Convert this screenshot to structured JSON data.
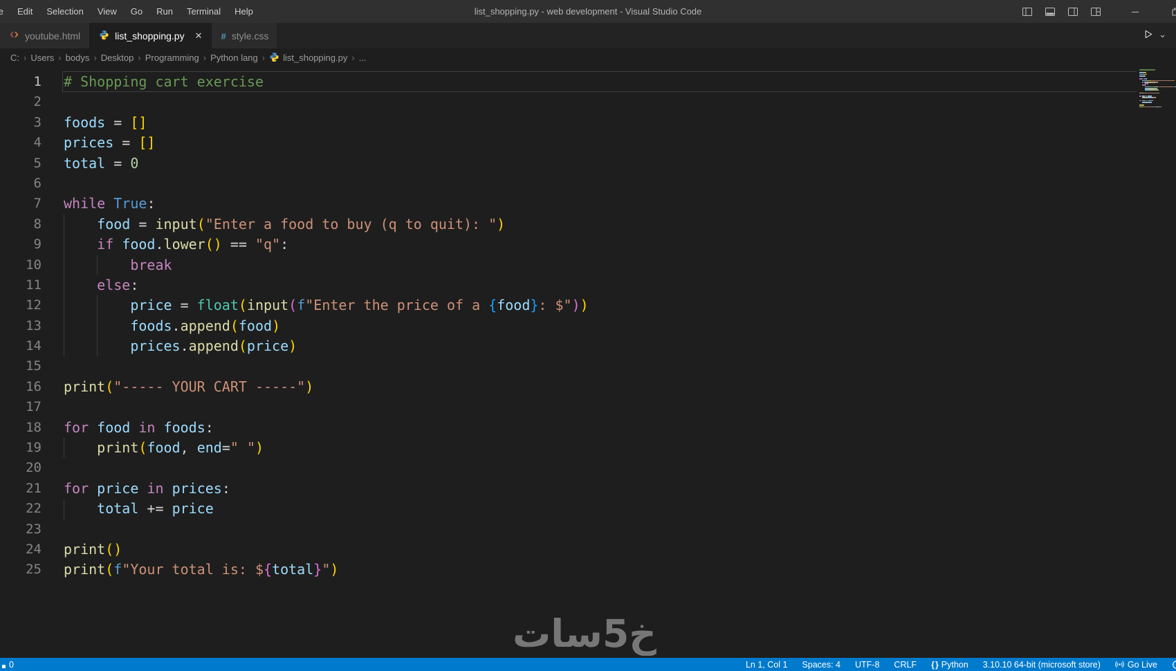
{
  "window": {
    "title": "list_shopping.py - web development - Visual Studio Code",
    "menu_items": [
      "File",
      "Edit",
      "Selection",
      "View",
      "Go",
      "Run",
      "Terminal",
      "Help"
    ],
    "controls": [
      "layout-sidebar-left-icon",
      "layout-panel-icon",
      "layout-sidebar-right-icon",
      "layout-customize-icon",
      "minimize-icon",
      "restore-icon"
    ]
  },
  "tab_bar": {
    "tabs": [
      {
        "label": "youtube.html",
        "icon": "html-icon",
        "active": false
      },
      {
        "label": "list_shopping.py",
        "icon": "python-icon",
        "active": true,
        "close": "✕"
      },
      {
        "label": "style.css",
        "icon": "css-icon",
        "active": false
      }
    ],
    "run_icon": "play-icon",
    "run_dropdown": "⌄"
  },
  "breadcrumb": {
    "items": [
      {
        "label": "C:"
      },
      {
        "label": "Users"
      },
      {
        "label": "bodys"
      },
      {
        "label": "Desktop"
      },
      {
        "label": "Programming"
      },
      {
        "label": "Python lang"
      },
      {
        "label": "list_shopping.py",
        "icon": "python-icon"
      },
      {
        "label": "..."
      }
    ],
    "separator": "›"
  },
  "editor": {
    "palette": {
      "ws": "#d4d4d4",
      "comment": "#6a9955",
      "var": "#9cdcfe",
      "kw": "#c586c0",
      "const": "#569cd6",
      "func": "#dcdcaa",
      "type": "#4ec9b0",
      "str": "#ce9178",
      "num": "#b5cea8",
      "op": "#d4d4d4",
      "b1": "#ffd700",
      "b2": "#da70d6",
      "b3": "#179fff"
    },
    "cursor": "Ln 1, Col 1",
    "lines": [
      {
        "n": 1,
        "current": true,
        "spans": [
          {
            "t": "# Shopping cart exercise",
            "c": "comment"
          }
        ]
      },
      {
        "n": 2,
        "spans": []
      },
      {
        "n": 3,
        "spans": [
          {
            "t": "foods",
            "c": "var"
          },
          {
            "t": " = ",
            "c": "op"
          },
          {
            "t": "[]",
            "c": "b1"
          }
        ]
      },
      {
        "n": 4,
        "spans": [
          {
            "t": "prices",
            "c": "var"
          },
          {
            "t": " = ",
            "c": "op"
          },
          {
            "t": "[]",
            "c": "b1"
          }
        ]
      },
      {
        "n": 5,
        "spans": [
          {
            "t": "total",
            "c": "var"
          },
          {
            "t": " = ",
            "c": "op"
          },
          {
            "t": "0",
            "c": "num"
          }
        ]
      },
      {
        "n": 6,
        "spans": []
      },
      {
        "n": 7,
        "spans": [
          {
            "t": "while",
            "c": "kw"
          },
          {
            "t": " ",
            "c": "ws"
          },
          {
            "t": "True",
            "c": "const"
          },
          {
            "t": ":",
            "c": "op"
          }
        ]
      },
      {
        "n": 8,
        "guides": [
          0
        ],
        "spans": [
          {
            "t": "    ",
            "c": "ws"
          },
          {
            "t": "food",
            "c": "var"
          },
          {
            "t": " = ",
            "c": "op"
          },
          {
            "t": "input",
            "c": "func"
          },
          {
            "t": "(",
            "c": "b1"
          },
          {
            "t": "\"Enter a food to buy (q to quit): \"",
            "c": "str"
          },
          {
            "t": ")",
            "c": "b1"
          }
        ]
      },
      {
        "n": 9,
        "guides": [
          0
        ],
        "spans": [
          {
            "t": "    ",
            "c": "ws"
          },
          {
            "t": "if",
            "c": "kw"
          },
          {
            "t": " ",
            "c": "ws"
          },
          {
            "t": "food",
            "c": "var"
          },
          {
            "t": ".",
            "c": "op"
          },
          {
            "t": "lower",
            "c": "func"
          },
          {
            "t": "()",
            "c": "b1"
          },
          {
            "t": " == ",
            "c": "op"
          },
          {
            "t": "\"q\"",
            "c": "str"
          },
          {
            "t": ":",
            "c": "op"
          }
        ]
      },
      {
        "n": 10,
        "guides": [
          0,
          1
        ],
        "spans": [
          {
            "t": "        ",
            "c": "ws"
          },
          {
            "t": "break",
            "c": "kw"
          }
        ]
      },
      {
        "n": 11,
        "guides": [
          0
        ],
        "spans": [
          {
            "t": "    ",
            "c": "ws"
          },
          {
            "t": "else",
            "c": "kw"
          },
          {
            "t": ":",
            "c": "op"
          }
        ]
      },
      {
        "n": 12,
        "guides": [
          0,
          1
        ],
        "spans": [
          {
            "t": "        ",
            "c": "ws"
          },
          {
            "t": "price",
            "c": "var"
          },
          {
            "t": " = ",
            "c": "op"
          },
          {
            "t": "float",
            "c": "type"
          },
          {
            "t": "(",
            "c": "b1"
          },
          {
            "t": "input",
            "c": "func"
          },
          {
            "t": "(",
            "c": "b2"
          },
          {
            "t": "f",
            "c": "const"
          },
          {
            "t": "\"Enter the price of a ",
            "c": "str"
          },
          {
            "t": "{",
            "c": "b3"
          },
          {
            "t": "food",
            "c": "var"
          },
          {
            "t": "}",
            "c": "b3"
          },
          {
            "t": ": $\"",
            "c": "str"
          },
          {
            "t": ")",
            "c": "b2"
          },
          {
            "t": ")",
            "c": "b1"
          }
        ]
      },
      {
        "n": 13,
        "guides": [
          0,
          1
        ],
        "spans": [
          {
            "t": "        ",
            "c": "ws"
          },
          {
            "t": "foods",
            "c": "var"
          },
          {
            "t": ".",
            "c": "op"
          },
          {
            "t": "append",
            "c": "func"
          },
          {
            "t": "(",
            "c": "b1"
          },
          {
            "t": "food",
            "c": "var"
          },
          {
            "t": ")",
            "c": "b1"
          }
        ]
      },
      {
        "n": 14,
        "guides": [
          0,
          1
        ],
        "spans": [
          {
            "t": "        ",
            "c": "ws"
          },
          {
            "t": "prices",
            "c": "var"
          },
          {
            "t": ".",
            "c": "op"
          },
          {
            "t": "append",
            "c": "func"
          },
          {
            "t": "(",
            "c": "b1"
          },
          {
            "t": "price",
            "c": "var"
          },
          {
            "t": ")",
            "c": "b1"
          }
        ]
      },
      {
        "n": 15,
        "spans": []
      },
      {
        "n": 16,
        "spans": [
          {
            "t": "print",
            "c": "func"
          },
          {
            "t": "(",
            "c": "b1"
          },
          {
            "t": "\"----- YOUR CART -----\"",
            "c": "str"
          },
          {
            "t": ")",
            "c": "b1"
          }
        ]
      },
      {
        "n": 17,
        "spans": []
      },
      {
        "n": 18,
        "spans": [
          {
            "t": "for",
            "c": "kw"
          },
          {
            "t": " ",
            "c": "ws"
          },
          {
            "t": "food",
            "c": "var"
          },
          {
            "t": " ",
            "c": "ws"
          },
          {
            "t": "in",
            "c": "kw"
          },
          {
            "t": " ",
            "c": "ws"
          },
          {
            "t": "foods",
            "c": "var"
          },
          {
            "t": ":",
            "c": "op"
          }
        ]
      },
      {
        "n": 19,
        "guides": [
          0
        ],
        "spans": [
          {
            "t": "    ",
            "c": "ws"
          },
          {
            "t": "print",
            "c": "func"
          },
          {
            "t": "(",
            "c": "b1"
          },
          {
            "t": "food",
            "c": "var"
          },
          {
            "t": ", ",
            "c": "op"
          },
          {
            "t": "end",
            "c": "var"
          },
          {
            "t": "=",
            "c": "op"
          },
          {
            "t": "\" \"",
            "c": "str"
          },
          {
            "t": ")",
            "c": "b1"
          }
        ]
      },
      {
        "n": 20,
        "spans": []
      },
      {
        "n": 21,
        "spans": [
          {
            "t": "for",
            "c": "kw"
          },
          {
            "t": " ",
            "c": "ws"
          },
          {
            "t": "price",
            "c": "var"
          },
          {
            "t": " ",
            "c": "ws"
          },
          {
            "t": "in",
            "c": "kw"
          },
          {
            "t": " ",
            "c": "ws"
          },
          {
            "t": "prices",
            "c": "var"
          },
          {
            "t": ":",
            "c": "op"
          }
        ]
      },
      {
        "n": 22,
        "guides": [
          0
        ],
        "spans": [
          {
            "t": "    ",
            "c": "ws"
          },
          {
            "t": "total",
            "c": "var"
          },
          {
            "t": " += ",
            "c": "op"
          },
          {
            "t": "price",
            "c": "var"
          }
        ]
      },
      {
        "n": 23,
        "spans": []
      },
      {
        "n": 24,
        "spans": [
          {
            "t": "print",
            "c": "func"
          },
          {
            "t": "()",
            "c": "b1"
          }
        ]
      },
      {
        "n": 25,
        "spans": [
          {
            "t": "print",
            "c": "func"
          },
          {
            "t": "(",
            "c": "b1"
          },
          {
            "t": "f",
            "c": "const"
          },
          {
            "t": "\"Your total is: $",
            "c": "str"
          },
          {
            "t": "{",
            "c": "b2"
          },
          {
            "t": "total",
            "c": "var"
          },
          {
            "t": "}",
            "c": "b2"
          },
          {
            "t": "\"",
            "c": "str"
          },
          {
            "t": ")",
            "c": "b1"
          }
        ]
      }
    ]
  },
  "status_bar": {
    "background": "#007acc",
    "left": [
      {
        "name": "status-problems",
        "icon": "dot-icon",
        "label": "0"
      }
    ],
    "right": [
      {
        "name": "status-cursor-position",
        "label": "Ln 1, Col 1"
      },
      {
        "name": "status-indentation",
        "label": "Spaces: 4"
      },
      {
        "name": "status-encoding",
        "label": "UTF-8"
      },
      {
        "name": "status-eol",
        "label": "CRLF"
      },
      {
        "name": "status-language-mode",
        "icon": "braces-icon",
        "label": "Python"
      },
      {
        "name": "status-python-interpreter",
        "label": "3.10.10 64-bit (microsoft store)"
      },
      {
        "name": "status-go-live",
        "icon": "broadcast-icon",
        "label": "Go Live"
      },
      {
        "name": "status-edge-partial",
        "icon": "partial-circle-icon",
        "label": ""
      }
    ]
  },
  "watermark": {
    "text": "خ5سات"
  }
}
